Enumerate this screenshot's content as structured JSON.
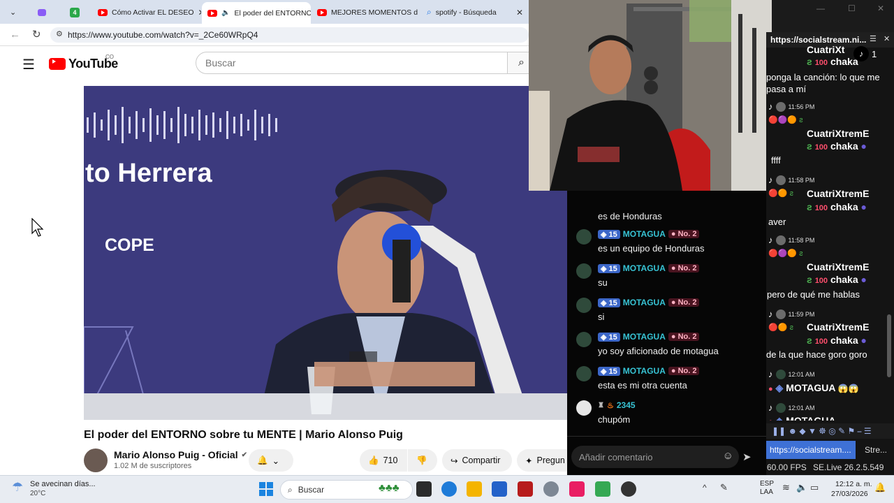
{
  "browser": {
    "tabs": [
      {
        "label": ""
      },
      {
        "label": ""
      },
      {
        "label": ""
      },
      {
        "label": "Cómo Activar EL DESEO"
      },
      {
        "label": "El poder del ENTORNO"
      },
      {
        "label": "MEJORES MOMENTOS d"
      },
      {
        "label": "spotify - Búsqueda"
      }
    ],
    "tab_badge": "4",
    "url": "https://www.youtube.com/watch?v=_2Ce60WRpQ4"
  },
  "youtube": {
    "logo": "YouTube",
    "region": "CO",
    "search_placeholder": "Buscar",
    "video_overlay_text": "to Herrera",
    "video_overlay_brand": "COPE",
    "video_title": "El poder del ENTORNO sobre tu MENTE | Mario Alonso Puig",
    "channel_name": "Mario Alonso Puig - Oficial",
    "subscribers": "1.02 M de suscriptores",
    "likes": "710",
    "share_label": "Compartir",
    "ask_label": "Pregun"
  },
  "chat_mid": {
    "top_cut_text": "es de Honduras",
    "messages": [
      {
        "level": "15",
        "name": "MOTAGUA",
        "rank": "No. 2",
        "text": "es un equipo de Honduras"
      },
      {
        "level": "15",
        "name": "MOTAGUA",
        "rank": "No. 2",
        "text": "su"
      },
      {
        "level": "15",
        "name": "MOTAGUA",
        "rank": "No. 2",
        "text": "si"
      },
      {
        "level": "15",
        "name": "MOTAGUA",
        "rank": "No. 2",
        "text": "yo soy aficionado de motagua"
      },
      {
        "level": "15",
        "name": "MOTAGUA",
        "rank": "No. 2",
        "text": "esta es mi otra cuenta"
      }
    ],
    "last": {
      "name": "2345",
      "text": "chupóm"
    },
    "comment_placeholder": "Añadir comentario"
  },
  "chat_right": {
    "titlebar": "https://socialstream.ni...",
    "like_count": "1",
    "entries": [
      {
        "name": "CuatriXt",
        "extra": "chaka",
        "message": "ponga la canción: lo que me pasa a mí"
      },
      {
        "time": "11:56 PM",
        "name": "CuatriXtremE",
        "extra": "chaka",
        "message": "ffff"
      },
      {
        "time": "11:58 PM",
        "name": "CuatriXtremE",
        "extra": "chaka",
        "message": "aver"
      },
      {
        "time": "11:58 PM",
        "name": "CuatriXtremE",
        "extra": "chaka",
        "message": "pero de qué me hablas"
      },
      {
        "time": "11:59 PM",
        "name": "CuatriXtremE",
        "extra": "chaka",
        "message": "de la que hace goro goro"
      },
      {
        "time": "12:01 AM",
        "name": "MOTAGUA",
        "message": ""
      },
      {
        "time": "12:01 AM",
        "name": "MOTAGUA",
        "message": ""
      }
    ],
    "bottom_link": "https://socialstream....",
    "bottom_link2": "Stre...",
    "fps": "60.00 FPS",
    "version": "SE.Live 26.2.5.549"
  },
  "taskbar": {
    "weather_text": "Se avecinan días...",
    "temperature": "20°C",
    "search_label": "Buscar",
    "lang": "ESP",
    "lang2": "LAA",
    "time": "12:12 a. m.",
    "date": "27/03/2026"
  }
}
